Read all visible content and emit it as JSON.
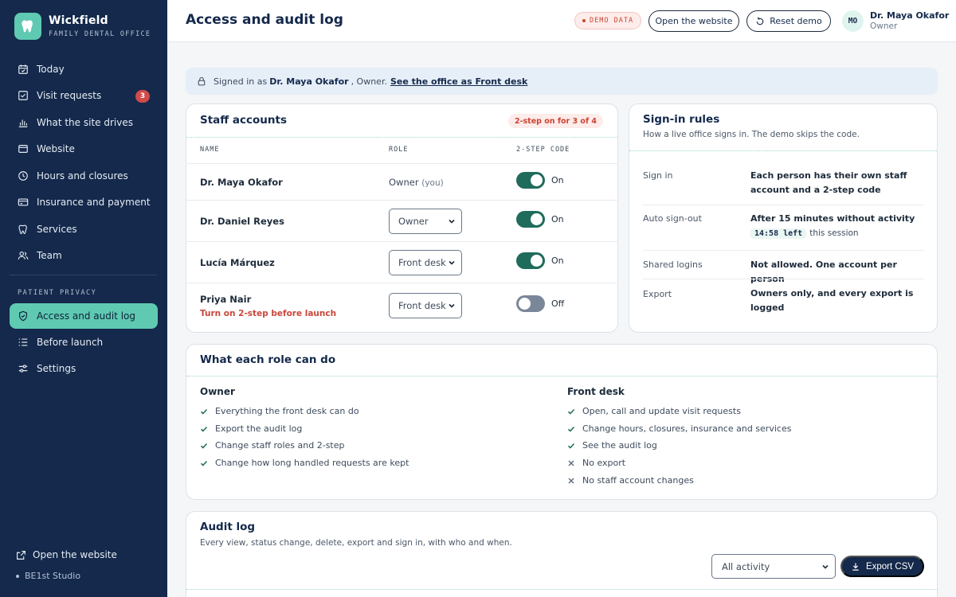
{
  "brand": {
    "name": "Wickfield",
    "subtitle": "FAMILY DENTAL OFFICE"
  },
  "sidebar": {
    "items": [
      {
        "label": "Today",
        "icon": "calendar-icon"
      },
      {
        "label": "Visit requests",
        "icon": "inbox-icon",
        "badge": "3"
      },
      {
        "label": "What the site drives",
        "icon": "bar-chart-icon"
      },
      {
        "label": "Website",
        "icon": "browser-icon"
      },
      {
        "label": "Hours and closures",
        "icon": "clock-icon"
      },
      {
        "label": "Insurance and payment",
        "icon": "card-icon"
      },
      {
        "label": "Services",
        "icon": "tooth-icon"
      },
      {
        "label": "Team",
        "icon": "users-icon"
      }
    ],
    "section_label": "PATIENT PRIVACY",
    "privacy_items": [
      {
        "label": "Access and audit log",
        "icon": "shield-icon",
        "active": true
      },
      {
        "label": "Before launch",
        "icon": "checklist-icon"
      },
      {
        "label": "Settings",
        "icon": "sliders-icon"
      }
    ],
    "footer_link": "Open the website",
    "footer_credit": "BE1st Studio"
  },
  "header": {
    "title": "Access and audit log",
    "demo_badge": "DEMO DATA",
    "open_website": "Open the website",
    "reset_demo": "Reset demo",
    "avatar_initials": "MO",
    "user_name": "Dr. Maya Okafor",
    "user_role": "Owner"
  },
  "banner": {
    "prefix": "Signed in as",
    "user": "Dr. Maya Okafor",
    "suffix": ", Owner.",
    "link": "See the office as Front desk"
  },
  "staff": {
    "title": "Staff accounts",
    "status_pill": "2-step on for 3 of 4",
    "columns": [
      "NAME",
      "ROLE",
      "2-STEP CODE"
    ],
    "rows": [
      {
        "name": "Dr. Maya Okafor",
        "role": "Owner",
        "role_note": "(you)",
        "two_step": "On",
        "two_step_on": true
      },
      {
        "name": "Dr. Daniel Reyes",
        "role": "Owner",
        "two_step": "On",
        "two_step_on": true
      },
      {
        "name": "Lucía Márquez",
        "role": "Front desk",
        "two_step": "On",
        "two_step_on": true
      },
      {
        "name": "Priya Nair",
        "warning": "Turn on 2-step before launch",
        "role": "Front desk",
        "two_step": "Off",
        "two_step_on": false
      }
    ]
  },
  "rules": {
    "title": "Sign-in rules",
    "subtitle": "How a live office signs in. The demo skips the code.",
    "items": [
      {
        "key": "Sign in",
        "value": "Each person has their own staff account and a 2-step code"
      },
      {
        "key": "Auto sign-out",
        "value": "After 15 minutes without activity",
        "timer": "14:58 left",
        "timer_note": "this session"
      },
      {
        "key": "Shared logins",
        "value": "Not allowed. One account per person"
      },
      {
        "key": "Export",
        "value": "Owners only, and every export is logged"
      }
    ]
  },
  "roles": {
    "title": "What each role can do",
    "owner": {
      "name": "Owner",
      "perms": [
        {
          "text": "Everything the front desk can do",
          "allowed": true
        },
        {
          "text": "Export the audit log",
          "allowed": true
        },
        {
          "text": "Change staff roles and 2-step",
          "allowed": true
        },
        {
          "text": "Change how long handled requests are kept",
          "allowed": true
        }
      ]
    },
    "front_desk": {
      "name": "Front desk",
      "perms": [
        {
          "text": "Open, call and update visit requests",
          "allowed": true
        },
        {
          "text": "Change hours, closures, insurance and services",
          "allowed": true
        },
        {
          "text": "See the audit log",
          "allowed": true
        },
        {
          "text": "No export",
          "allowed": false
        },
        {
          "text": "No staff account changes",
          "allowed": false
        }
      ]
    }
  },
  "audit": {
    "title": "Audit log",
    "subtitle": "Every view, status change, delete, export and sign in, with who and when.",
    "filter": "All activity",
    "export": "Export CSV"
  },
  "colors": {
    "sidebar": "#14294b",
    "accent": "#5fc9b2",
    "danger": "#cc4433",
    "toggle_on": "#1f6b5c"
  }
}
